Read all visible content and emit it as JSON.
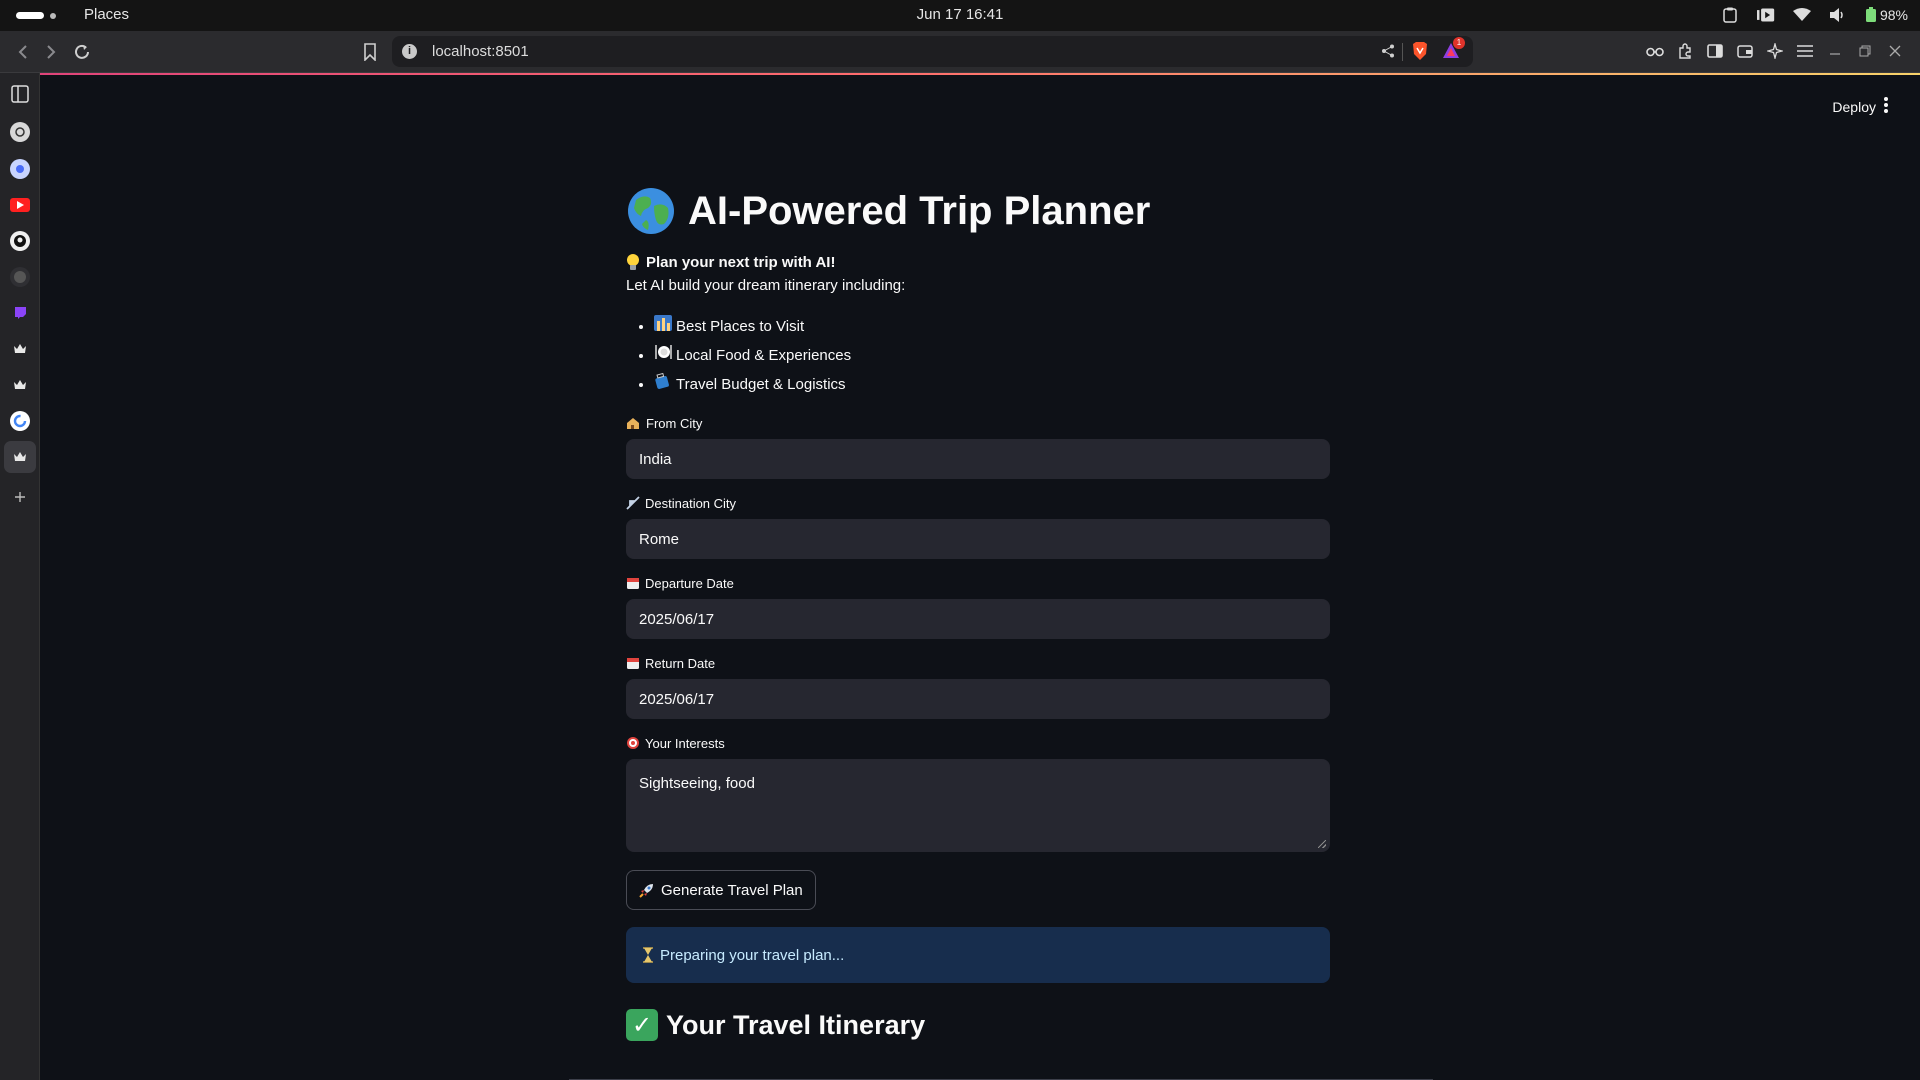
{
  "os": {
    "app_name": "Places",
    "clock": "Jun 17  16:41",
    "battery": "98%"
  },
  "browser": {
    "url": "localhost:8501",
    "notification_count": "1"
  },
  "app": {
    "deploy_label": "Deploy",
    "title": "AI-Powered Trip Planner",
    "lead": "Plan your next trip with AI!",
    "subtitle": "Let AI build your dream itinerary including:",
    "features": [
      "Best Places to Visit",
      "Local Food & Experiences",
      "Travel Budget & Logistics"
    ],
    "fields": {
      "from_city": {
        "label": "From City",
        "value": "India"
      },
      "destination_city": {
        "label": "Destination City",
        "value": "Rome"
      },
      "departure_date": {
        "label": "Departure Date",
        "value": "2025/06/17"
      },
      "return_date": {
        "label": "Return Date",
        "value": "2025/06/17"
      },
      "interests": {
        "label": "Your Interests",
        "value": "Sightseeing, food"
      }
    },
    "generate_button": "Generate Travel Plan",
    "status_message": "Preparing your travel plan...",
    "itinerary_heading": "Your Travel Itinerary"
  },
  "colors": {
    "background": "#0e1117",
    "input_bg": "#262730",
    "info_bg": "#172d4d",
    "info_text": "#c7ebff",
    "accent_gradient_start": "#e0447a",
    "accent_gradient_end": "#f7d26a"
  }
}
